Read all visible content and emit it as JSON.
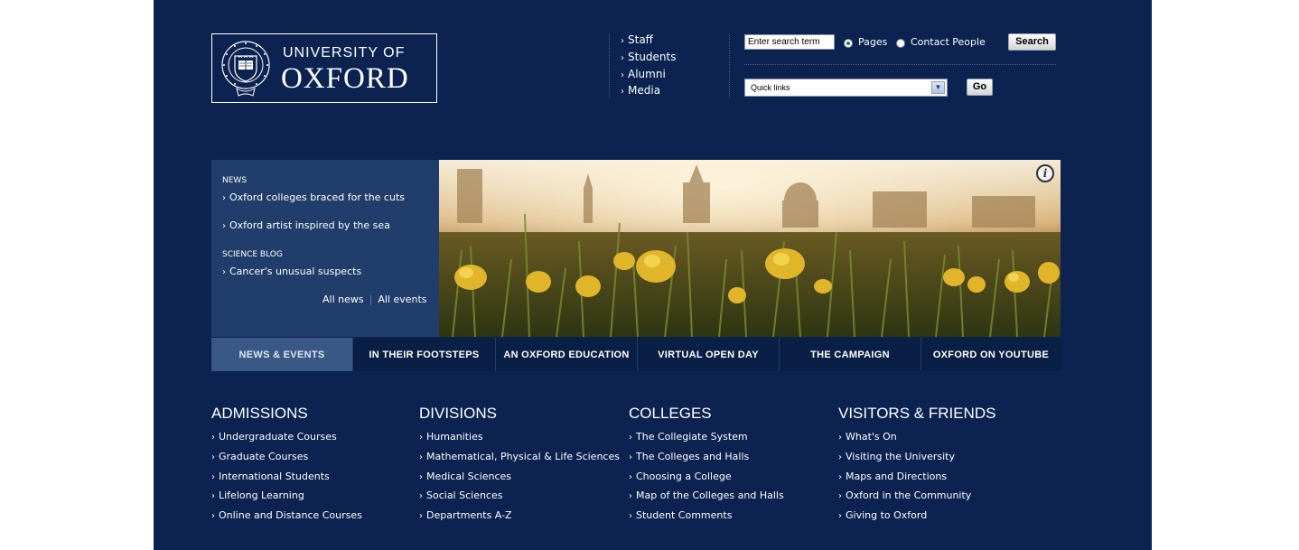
{
  "header": {
    "logo_line1": "UNIVERSITY OF",
    "logo_line2": "OXFORD",
    "audience_links": [
      "Staff",
      "Students",
      "Alumni",
      "Media"
    ]
  },
  "search": {
    "input_value": "Enter search term",
    "radio_pages": "Pages",
    "radio_people": "Contact People",
    "selected_scope": "Pages",
    "button_label": "Search",
    "quicklinks_value": "Quick links",
    "go_label": "Go"
  },
  "news": {
    "news_heading": "NEWS",
    "items": [
      "Oxford colleges braced for the cuts",
      "Oxford artist inspired by the sea"
    ],
    "blog_heading": "SCIENCE BLOG",
    "blog_items": [
      "Cancer's unusual suspects"
    ],
    "all_news": "All news",
    "all_events": "All events"
  },
  "tabs": [
    "NEWS & EVENTS",
    "IN THEIR FOOTSTEPS",
    "AN OXFORD EDUCATION",
    "VIRTUAL OPEN DAY",
    "THE CAMPAIGN",
    "OXFORD ON YOUTUBE"
  ],
  "active_tab": "NEWS & EVENTS",
  "columns": [
    {
      "title": "ADMISSIONS",
      "links": [
        "Undergraduate Courses",
        "Graduate Courses",
        "International Students",
        "Lifelong Learning",
        "Online and Distance Courses"
      ]
    },
    {
      "title": "DIVISIONS",
      "links": [
        "Humanities",
        "Mathematical, Physical & Life Sciences",
        "Medical Sciences",
        "Social Sciences",
        "Departments A-Z"
      ]
    },
    {
      "title": "COLLEGES",
      "links": [
        "The Collegiate System",
        "The Colleges and Halls",
        "Choosing a College",
        "Map of the Colleges and Halls",
        "Student Comments"
      ]
    },
    {
      "title": "VISITORS & FRIENDS",
      "links": [
        "What's On",
        "Visiting the University",
        "Maps and Directions",
        "Oxford in the Community",
        "Giving to Oxford"
      ]
    }
  ],
  "colors": {
    "page_bg": "#0c2351",
    "panel_bg": "#213d6b",
    "tab_bg": "#0a1f45",
    "active_tab_bg": "#3a5886",
    "text": "#ffffff"
  },
  "icons": {
    "info": "info-icon",
    "seal": "university-seal-icon",
    "chevron": "chevron-right-icon",
    "dropdown": "chevron-down-icon"
  }
}
